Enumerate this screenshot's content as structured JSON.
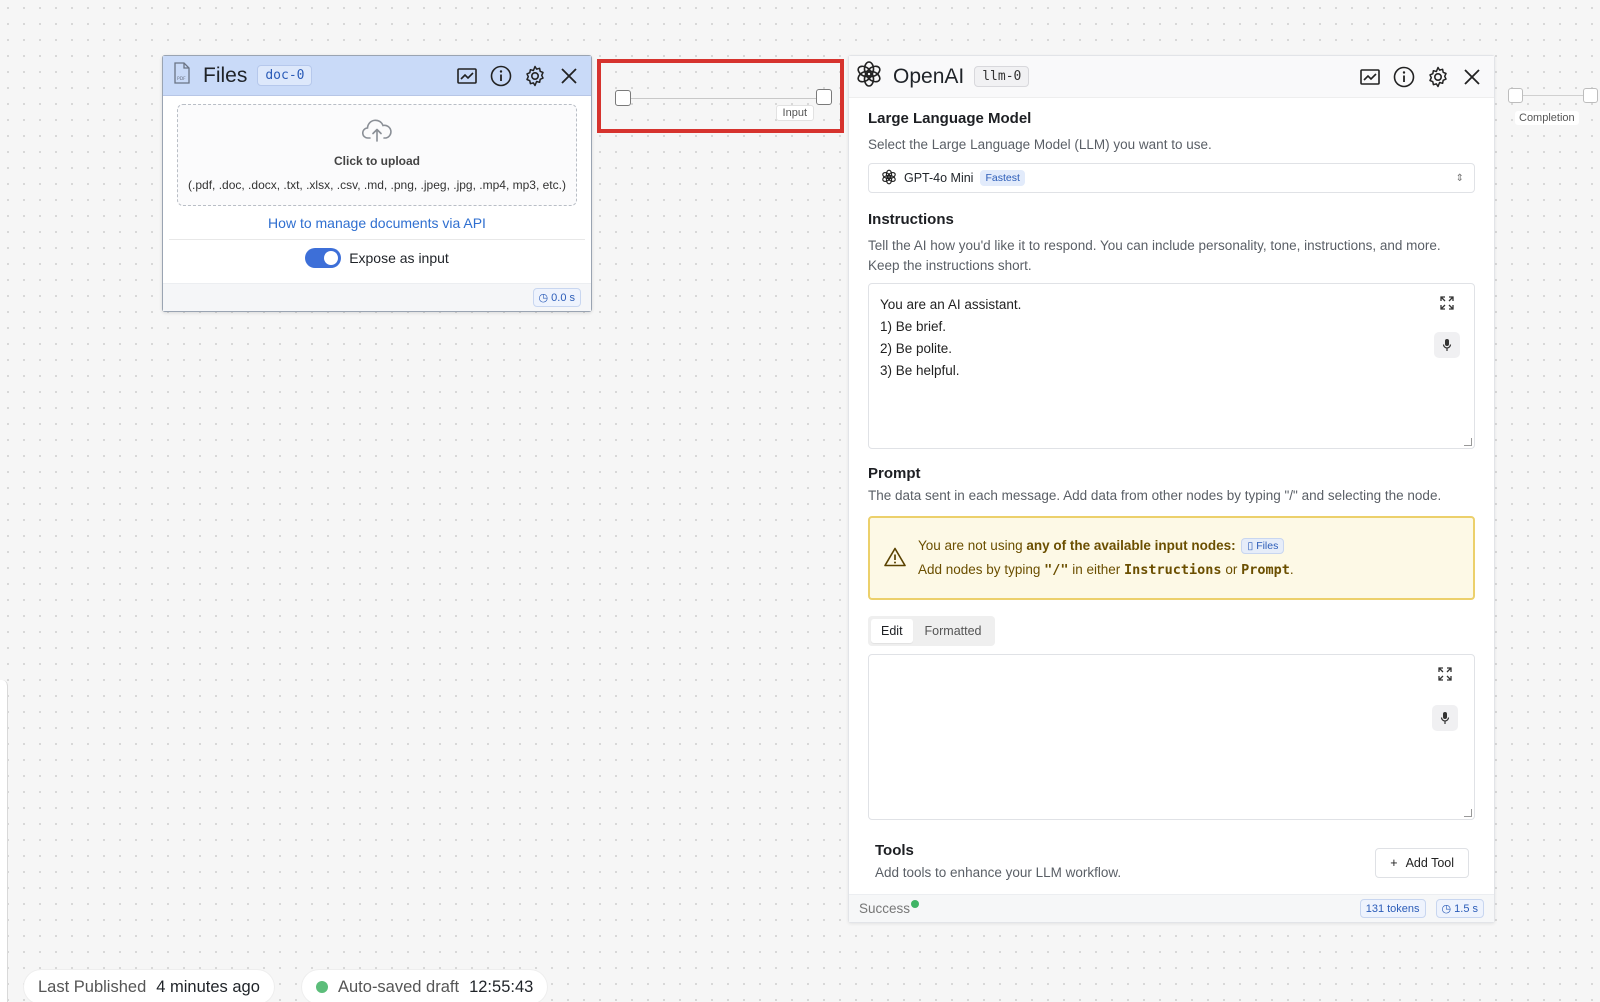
{
  "files_node": {
    "title": "Files",
    "tag": "doc-0",
    "upload_label": "Click to upload",
    "upload_formats": "(.pdf, .doc, .docx, .txt, .xlsx, .csv, .md, .png, .jpeg, .jpg, .mp4, mp3, etc.)",
    "api_link": "How to manage documents via API",
    "expose_label": "Expose as input",
    "expose_enabled": true,
    "time": "0.0 s"
  },
  "connector": {
    "label": "Input"
  },
  "llm_node": {
    "title": "OpenAI",
    "tag": "llm-0",
    "model_section": {
      "title": "Large Language Model",
      "description": "Select the Large Language Model (LLM) you want to use.",
      "selected_model": "GPT-4o Mini",
      "model_badge": "Fastest"
    },
    "instructions_section": {
      "title": "Instructions",
      "description": "Tell the AI how you'd like it to respond. You can include personality, tone, instructions, and more. Keep the instructions short.",
      "lines": [
        "You are an AI assistant.",
        "1) Be brief.",
        "2) Be polite.",
        "3) Be helpful."
      ]
    },
    "prompt_section": {
      "title": "Prompt",
      "description": "The data sent in each message. Add data from other nodes by typing \"/\" and selecting the node.",
      "warning_prefix": "You are not using ",
      "warning_bold": "any of the available input nodes:",
      "warning_chip": "Files",
      "warning_line2_a": "Add nodes by typing ",
      "warning_line2_slash": "\"/\"",
      "warning_line2_b": " in either ",
      "warning_line2_instr": "Instructions",
      "warning_line2_or": " or ",
      "warning_line2_prompt": "Prompt",
      "warning_line2_end": ".",
      "tabs": [
        "Edit",
        "Formatted"
      ],
      "active_tab": "Edit",
      "value": ""
    },
    "tools_section": {
      "title": "Tools",
      "description": "Add tools to enhance your LLM workflow.",
      "add_button": "Add Tool"
    },
    "footer": {
      "status": "Success",
      "tokens": "131 tokens",
      "time": "1.5 s"
    }
  },
  "output_handle": {
    "label": "Completion"
  },
  "status_bar": {
    "published_label": "Last Published",
    "published_value": "4 minutes ago",
    "autosave_label": "Auto-saved draft",
    "autosave_value": "12:55:43"
  },
  "colors": {
    "accent": "#3d6fd8",
    "files_header": "#c9daf8",
    "warning_border": "#ecd06b",
    "success": "#3fb465",
    "highlight": "#d6332e"
  }
}
